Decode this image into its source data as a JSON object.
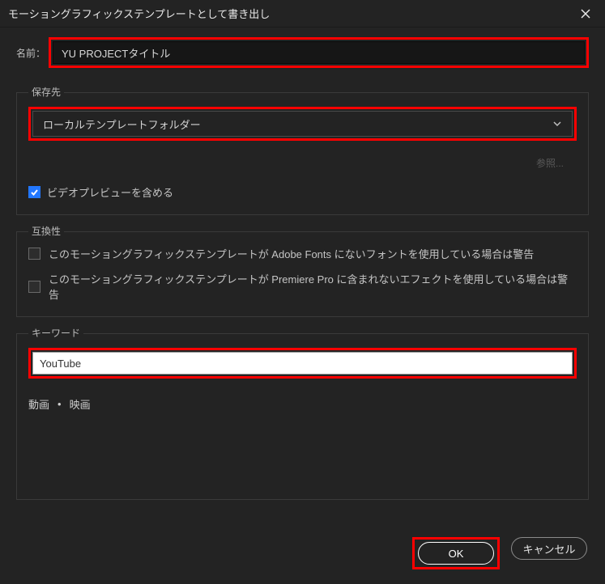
{
  "titlebar": {
    "title": "モーショングラフィックステンプレートとして書き出し"
  },
  "name_row": {
    "label": "名前：",
    "value": "YU PROJECTタイトル"
  },
  "save_section": {
    "label": "保存先",
    "selected": "ローカルテンプレートフォルダー",
    "browse": "参照...",
    "include_preview_label": "ビデオプレビューを含める"
  },
  "compat_section": {
    "label": "互換性",
    "item1": "このモーショングラフィックステンプレートが Adobe Fonts にないフォントを使用している場合は警告",
    "item2": "このモーショングラフィックステンプレートが Premiere Pro に含まれないエフェクトを使用している場合は警告"
  },
  "keyword_section": {
    "label": "キーワード",
    "value": "YouTube",
    "tag1": "動画",
    "tag2": "映画"
  },
  "footer": {
    "ok": "OK",
    "cancel": "キャンセル"
  }
}
